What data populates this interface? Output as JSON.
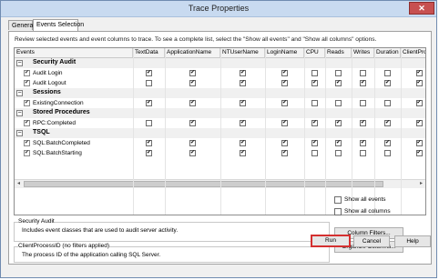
{
  "window": {
    "title": "Trace Properties",
    "close_glyph": "✕"
  },
  "tabs": [
    {
      "label": "General"
    },
    {
      "label": "Events Selection"
    }
  ],
  "instructions": "Review selected events and event columns to trace. To see a complete list, select the \"Show all events\" and \"Show all columns\" options.",
  "grid": {
    "columns": [
      "Events",
      "TextData",
      "ApplicationName",
      "NTUserName",
      "LoginName",
      "CPU",
      "Reads",
      "Writes",
      "Duration",
      "ClientProcess"
    ],
    "categories": [
      {
        "name": "Security Audit",
        "events": [
          {
            "name": "Audit Login",
            "checks": [
              1,
              1,
              1,
              1,
              0,
              0,
              0,
              0,
              1
            ]
          },
          {
            "name": "Audit Logout",
            "checks": [
              0,
              1,
              1,
              1,
              1,
              1,
              1,
              1,
              1
            ]
          }
        ]
      },
      {
        "name": "Sessions",
        "events": [
          {
            "name": "ExistingConnection",
            "checks": [
              1,
              1,
              1,
              1,
              0,
              0,
              0,
              0,
              1
            ]
          }
        ]
      },
      {
        "name": "Stored Procedures",
        "events": [
          {
            "name": "RPC:Completed",
            "checks": [
              0,
              1,
              1,
              1,
              1,
              1,
              1,
              1,
              1
            ]
          }
        ]
      },
      {
        "name": "TSQL",
        "events": [
          {
            "name": "SQL:BatchCompleted",
            "checks": [
              1,
              1,
              1,
              1,
              1,
              1,
              1,
              1,
              1
            ]
          },
          {
            "name": "SQL:BatchStarting",
            "checks": [
              1,
              1,
              1,
              1,
              0,
              0,
              0,
              0,
              1
            ]
          }
        ]
      }
    ],
    "expander_glyph": "−",
    "check_glyph": "✔",
    "scroll_left_glyph": "◂",
    "scroll_right_glyph": "▸"
  },
  "security_audit_box": {
    "label": "Security Audit",
    "description": "Includes event classes that are used to audit server activity."
  },
  "column_box": {
    "label": "ClientProcessID (no filters applied)",
    "description": "The process ID of the application calling SQL Server."
  },
  "options": {
    "show_all_events": {
      "label": "Show all events",
      "checked": false
    },
    "show_all_columns": {
      "label": "Show all columns",
      "checked": false
    }
  },
  "buttons": {
    "column_filters": "Column Filters...",
    "organize_columns": "Organize Columns...",
    "run": "Run",
    "cancel": "Cancel",
    "help": "Help"
  },
  "colors": {
    "run_highlight": "#d43030",
    "title_bar": "#c8daf0"
  }
}
